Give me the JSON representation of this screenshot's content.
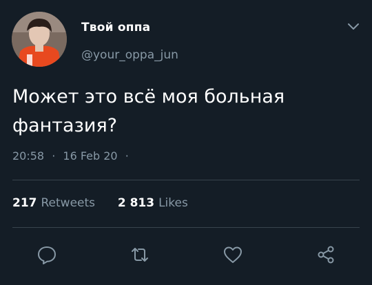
{
  "tweet": {
    "display_name": "Твой оппа",
    "username": "@your_oppa_jun",
    "text_line1": "Может это всё моя больная",
    "text_line2": "фантазия?",
    "time": "20:58",
    "date": "16 Feb 20",
    "dot": "·",
    "retweets_count": "217",
    "retweets_label": "Retweets",
    "likes_count": "2 813",
    "likes_label": "Likes"
  },
  "icons": {
    "menu": "chevron-down-icon",
    "reply": "reply-icon",
    "retweet": "retweet-icon",
    "like": "heart-icon",
    "share": "share-icon"
  },
  "colors": {
    "background": "#141d26",
    "text": "#ffffff",
    "secondary_text": "#8899a6",
    "divider": "#38444d",
    "avatar_jacket": "#e8491f"
  }
}
